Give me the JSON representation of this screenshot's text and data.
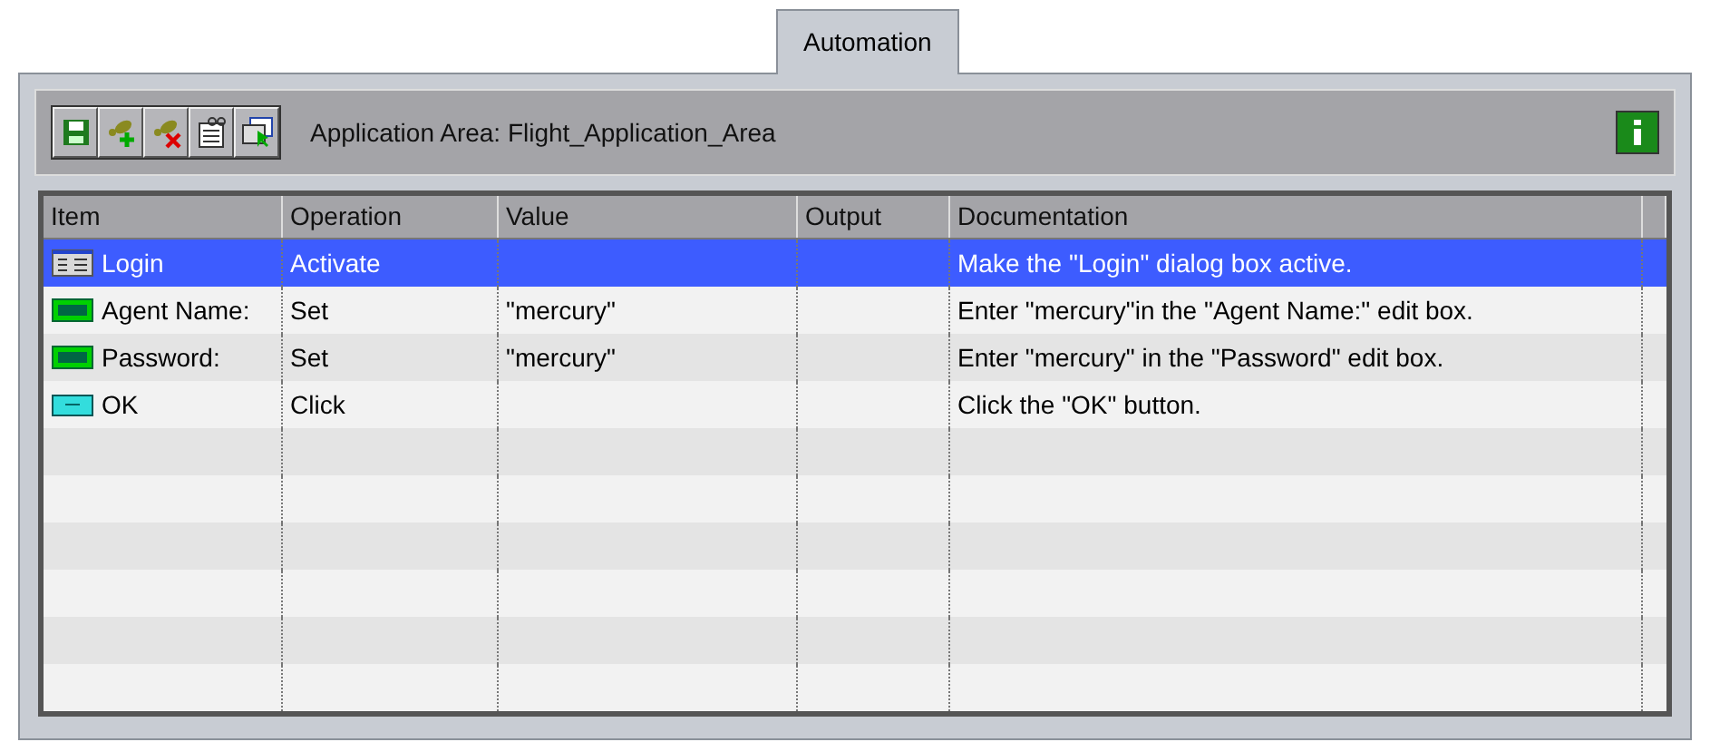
{
  "tabs": [
    {
      "label": "Automation",
      "selected": true
    }
  ],
  "toolbar": {
    "buttons": [
      {
        "kind": "save"
      },
      {
        "kind": "add"
      },
      {
        "kind": "remove"
      },
      {
        "kind": "properties"
      },
      {
        "kind": "select"
      }
    ],
    "application_area": "Application Area: Flight_Application_Area"
  },
  "table": {
    "columns": [
      "Item",
      "Operation",
      "Value",
      "Output",
      "Documentation"
    ],
    "rows": [
      {
        "item": "Login",
        "kind": "window",
        "operation": "Activate",
        "value": "",
        "output": "",
        "documentation": "Make the \"Login\" dialog box active.",
        "selected": true
      },
      {
        "item": "Agent Name:",
        "kind": "edit",
        "operation": "Set",
        "value": "\"mercury\"",
        "output": "",
        "documentation": "Enter \"mercury\"in the \"Agent Name:\" edit box.",
        "selected": false
      },
      {
        "item": "Password:",
        "kind": "edit",
        "operation": "Set",
        "value": "\"mercury\"",
        "output": "",
        "documentation": "Enter \"mercury\" in the \"Password\" edit box.",
        "selected": false
      },
      {
        "item": "OK",
        "kind": "button",
        "operation": "Click",
        "value": "",
        "output": "",
        "documentation": "Click the \"OK\" button.",
        "selected": false
      }
    ]
  }
}
